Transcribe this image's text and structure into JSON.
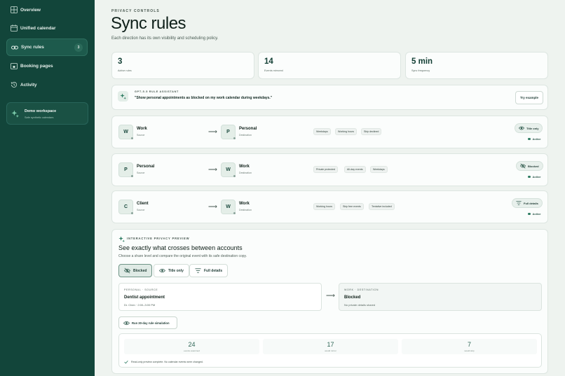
{
  "sidebar": {
    "items": [
      {
        "label": "Overview",
        "icon": "grid-icon"
      },
      {
        "label": "Unified calendar",
        "icon": "calendar-icon"
      },
      {
        "label": "Sync rules",
        "icon": "link-icon",
        "badge": "3",
        "active": true
      },
      {
        "label": "Booking pages",
        "icon": "booking-icon"
      },
      {
        "label": "Activity",
        "icon": "history-icon"
      }
    ],
    "workspace": {
      "name": "Demo workspace",
      "sub": "Safe synthetic calendars"
    }
  },
  "header": {
    "eyebrow": "PRIVACY CONTROLS",
    "title": "Sync rules",
    "subtitle": "Each direction has its own visibility and scheduling policy."
  },
  "stats": [
    {
      "value": "3",
      "label": "Active rules"
    },
    {
      "value": "14",
      "label": "Events mirrored"
    },
    {
      "value": "5 min",
      "label": "Sync frequency"
    }
  ],
  "assistant": {
    "label": "GPT-5.5 RULE ASSISTANT",
    "quote": "\"Show personal appointments as blocked on my work calendar during weekdays.\"",
    "button": "Try example"
  },
  "rules": [
    {
      "source": {
        "initial": "W",
        "name": "Work",
        "role": "Source"
      },
      "dest": {
        "initial": "P",
        "name": "Personal",
        "role": "Destination"
      },
      "chips": [
        "Weekdays",
        "Working hours",
        "Skip declined"
      ],
      "level": "Title only",
      "level_icon": "eye-icon",
      "status": "Active"
    },
    {
      "source": {
        "initial": "P",
        "name": "Personal",
        "role": "Source"
      },
      "dest": {
        "initial": "W",
        "name": "Work",
        "role": "Destination"
      },
      "chips": [
        "Private protected",
        "All-day events",
        "Weekdays"
      ],
      "level": "Blocked",
      "level_icon": "eye-off-icon",
      "status": "Active"
    },
    {
      "source": {
        "initial": "C",
        "name": "Client",
        "role": "Source"
      },
      "dest": {
        "initial": "W",
        "name": "Work",
        "role": "Destination"
      },
      "chips": [
        "Working hours",
        "Skip free events",
        "Tentative included"
      ],
      "level": "Full details",
      "level_icon": "filter-icon",
      "status": "Active"
    }
  ],
  "preview": {
    "label": "INTERACTIVE PRIVACY PREVIEW",
    "title": "See exactly what crosses between accounts",
    "subtitle": "Choose a share level and compare the original event with its safe destination copy.",
    "options": [
      "Blocked",
      "Title only",
      "Full details"
    ],
    "selected": "Blocked",
    "source_event": {
      "label": "PERSONAL · SOURCE",
      "title": "Dentist appointment",
      "sub": "Dr. Chen · 2:00–3:00 PM"
    },
    "dest_event": {
      "label": "WORK · DESTINATION",
      "title": "Blocked",
      "sub": "No private details shared"
    },
    "simulate_button": "Run 30-day rule simulation",
    "results": [
      {
        "value": "24",
        "label": "events examined"
      },
      {
        "value": "17",
        "label": "would mirror"
      },
      {
        "value": "7",
        "label": "would skip"
      }
    ],
    "note": "Read-only preview complete. No calendar events were changed."
  },
  "colors": {
    "sidebar": "#12453a",
    "accent": "#2f7d63",
    "background": "#eef3ef"
  }
}
